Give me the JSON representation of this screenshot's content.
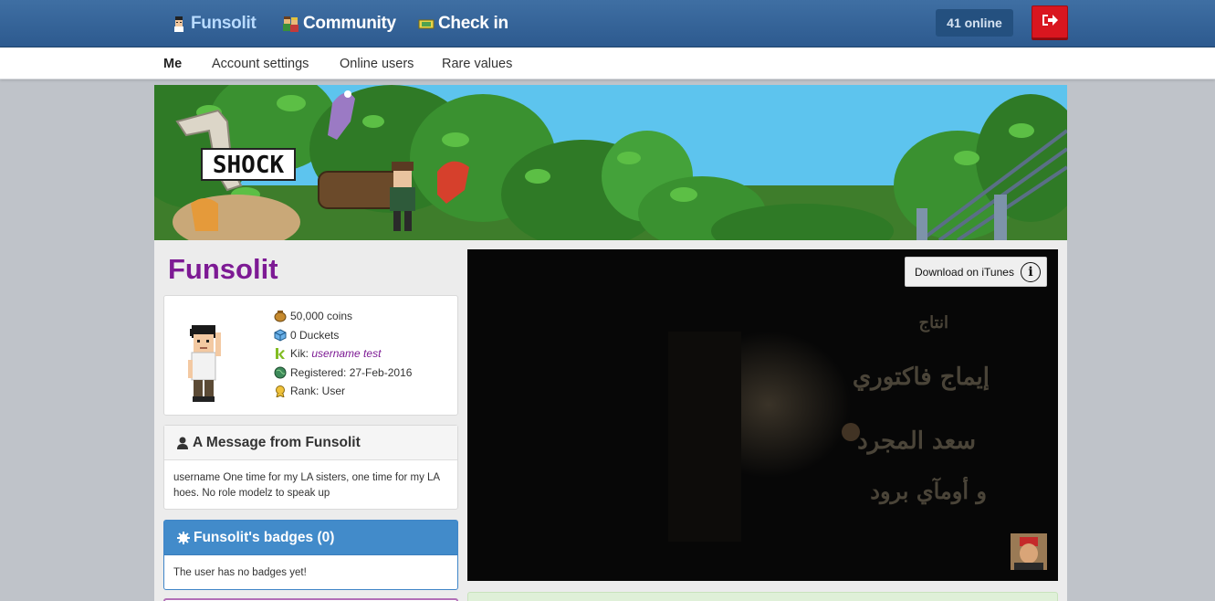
{
  "topnav": {
    "items": [
      {
        "label": "Funsolit",
        "icon": "avatar-icon"
      },
      {
        "label": "Community",
        "icon": "community-icon"
      },
      {
        "label": "Check in",
        "icon": "ticket-icon"
      }
    ],
    "online": "41 online",
    "logout_icon": "logout-icon"
  },
  "subnav": {
    "items": [
      "Me",
      "Account settings",
      "Online users",
      "Rare values"
    ]
  },
  "banner": {
    "sign_text": "SHOCK"
  },
  "profile": {
    "username": "Funsolit",
    "coins": "50,000 coins",
    "duckets": "0 Duckets",
    "kik_label": "Kik:",
    "kik_name": "username test",
    "registered": "Registered: 27-Feb-2016",
    "rank": "Rank: User"
  },
  "message": {
    "title": "A Message from Funsolit",
    "body": "username One time for my LA sisters, one time for my LA hoes. No role modelz to speak up"
  },
  "badges": {
    "title": "Funsolit's badges (0)",
    "body": "The user has no badges yet!"
  },
  "video": {
    "itunes_label": "Download on iTunes",
    "info_glyph": "i",
    "credits": [
      "انتاج",
      "إيماج فاكتوري",
      "سعد المجرد",
      "و أومآي برود"
    ]
  },
  "colors": {
    "topbar": "#3f6fa3",
    "username": "#7d1a94",
    "badge_header": "#428bca",
    "logout": "#d9161f"
  }
}
